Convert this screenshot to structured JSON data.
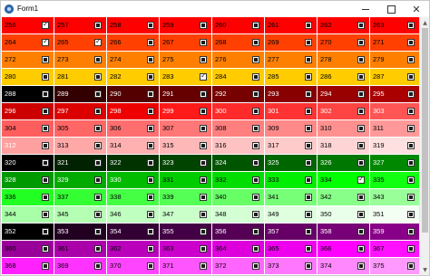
{
  "window": {
    "title": "Form1",
    "controls": {
      "minimize": "—",
      "maximize": "☐",
      "close": "✕"
    }
  },
  "scroll": {
    "up_glyph": "▲",
    "down_glyph": "▼"
  },
  "grid": {
    "rows": [
      {
        "cells": [
          {
            "n": "256",
            "bg": "#ff0000",
            "fg": "#000000",
            "checked": true
          },
          {
            "n": "257",
            "bg": "#ff0000",
            "fg": "#000000",
            "checked": false
          },
          {
            "n": "258",
            "bg": "#ff0000",
            "fg": "#000000",
            "checked": false
          },
          {
            "n": "259",
            "bg": "#ff0000",
            "fg": "#000000",
            "checked": false
          },
          {
            "n": "260",
            "bg": "#ff0000",
            "fg": "#000000",
            "checked": false
          },
          {
            "n": "261",
            "bg": "#ff0000",
            "fg": "#000000",
            "checked": false
          },
          {
            "n": "262",
            "bg": "#ff0000",
            "fg": "#000000",
            "checked": false
          },
          {
            "n": "263",
            "bg": "#ff0000",
            "fg": "#000000",
            "checked": false
          }
        ]
      },
      {
        "cells": [
          {
            "n": "264",
            "bg": "#ff4000",
            "fg": "#000000",
            "checked": true
          },
          {
            "n": "265",
            "bg": "#ff4000",
            "fg": "#000000",
            "checked": true
          },
          {
            "n": "266",
            "bg": "#ff4000",
            "fg": "#000000",
            "checked": false
          },
          {
            "n": "267",
            "bg": "#ff4000",
            "fg": "#000000",
            "checked": false
          },
          {
            "n": "268",
            "bg": "#ff4000",
            "fg": "#000000",
            "checked": false
          },
          {
            "n": "269",
            "bg": "#ff4000",
            "fg": "#000000",
            "checked": false
          },
          {
            "n": "270",
            "bg": "#ff4000",
            "fg": "#000000",
            "checked": false
          },
          {
            "n": "271",
            "bg": "#ff4000",
            "fg": "#000000",
            "checked": false
          }
        ]
      },
      {
        "cells": [
          {
            "n": "272",
            "bg": "#ff8000",
            "fg": "#000000",
            "checked": false
          },
          {
            "n": "273",
            "bg": "#ff8000",
            "fg": "#000000",
            "checked": false
          },
          {
            "n": "274",
            "bg": "#ff8000",
            "fg": "#000000",
            "checked": false
          },
          {
            "n": "275",
            "bg": "#ff8000",
            "fg": "#000000",
            "checked": false
          },
          {
            "n": "276",
            "bg": "#ff8000",
            "fg": "#000000",
            "checked": false
          },
          {
            "n": "277",
            "bg": "#ff8000",
            "fg": "#000000",
            "checked": false
          },
          {
            "n": "278",
            "bg": "#ff8000",
            "fg": "#000000",
            "checked": false
          },
          {
            "n": "279",
            "bg": "#ff8000",
            "fg": "#000000",
            "checked": false
          }
        ]
      },
      {
        "cells": [
          {
            "n": "280",
            "bg": "#ffcc00",
            "fg": "#000000",
            "checked": false
          },
          {
            "n": "281",
            "bg": "#ffcc00",
            "fg": "#000000",
            "checked": false
          },
          {
            "n": "282",
            "bg": "#ffcc00",
            "fg": "#000000",
            "checked": false
          },
          {
            "n": "283",
            "bg": "#ffcc00",
            "fg": "#000000",
            "checked": true
          },
          {
            "n": "284",
            "bg": "#ffcc00",
            "fg": "#000000",
            "checked": false
          },
          {
            "n": "285",
            "bg": "#ffcc00",
            "fg": "#000000",
            "checked": false
          },
          {
            "n": "286",
            "bg": "#ffcc00",
            "fg": "#000000",
            "checked": false
          },
          {
            "n": "287",
            "bg": "#ffcc00",
            "fg": "#000000",
            "checked": false
          }
        ]
      },
      {
        "cells": [
          {
            "n": "288",
            "bg": "#000000",
            "fg": "#ffffff",
            "checked": false
          },
          {
            "n": "289",
            "bg": "#330000",
            "fg": "#ffffff",
            "checked": false
          },
          {
            "n": "290",
            "bg": "#550000",
            "fg": "#ffffff",
            "checked": false
          },
          {
            "n": "291",
            "bg": "#660000",
            "fg": "#ffffff",
            "checked": false
          },
          {
            "n": "292",
            "bg": "#770000",
            "fg": "#ffffff",
            "checked": false
          },
          {
            "n": "293",
            "bg": "#880000",
            "fg": "#ffffff",
            "checked": false
          },
          {
            "n": "294",
            "bg": "#990000",
            "fg": "#ffffff",
            "checked": false
          },
          {
            "n": "295",
            "bg": "#aa0000",
            "fg": "#ffffff",
            "checked": false
          }
        ]
      },
      {
        "cells": [
          {
            "n": "296",
            "bg": "#cc0000",
            "fg": "#ffffff",
            "checked": false
          },
          {
            "n": "297",
            "bg": "#dd0000",
            "fg": "#ffffff",
            "checked": false
          },
          {
            "n": "298",
            "bg": "#ee0000",
            "fg": "#ffffff",
            "checked": false
          },
          {
            "n": "299",
            "bg": "#ff1a1a",
            "fg": "#ffffff",
            "checked": false
          },
          {
            "n": "300",
            "bg": "#ff2a2a",
            "fg": "#ffffff",
            "checked": false
          },
          {
            "n": "301",
            "bg": "#ff3333",
            "fg": "#ffffff",
            "checked": false
          },
          {
            "n": "302",
            "bg": "#ff4444",
            "fg": "#ffffff",
            "checked": false
          },
          {
            "n": "303",
            "bg": "#ff5555",
            "fg": "#ffffff",
            "checked": false
          }
        ]
      },
      {
        "cells": [
          {
            "n": "304",
            "bg": "#ff5e5e",
            "fg": "#000000",
            "checked": false
          },
          {
            "n": "305",
            "bg": "#ff6666",
            "fg": "#000000",
            "checked": false
          },
          {
            "n": "306",
            "bg": "#ff6e6e",
            "fg": "#000000",
            "checked": false
          },
          {
            "n": "307",
            "bg": "#ff7777",
            "fg": "#000000",
            "checked": false
          },
          {
            "n": "308",
            "bg": "#ff7f7f",
            "fg": "#000000",
            "checked": false
          },
          {
            "n": "309",
            "bg": "#ff8888",
            "fg": "#000000",
            "checked": false
          },
          {
            "n": "310",
            "bg": "#ff9090",
            "fg": "#000000",
            "checked": false
          },
          {
            "n": "311",
            "bg": "#ff9999",
            "fg": "#000000",
            "checked": false
          }
        ]
      },
      {
        "cells": [
          {
            "n": "312",
            "bg": "#ffa0a0",
            "fg": "#ffffff",
            "checked": false
          },
          {
            "n": "313",
            "bg": "#ffa8a8",
            "fg": "#000000",
            "checked": false
          },
          {
            "n": "314",
            "bg": "#ffb0b0",
            "fg": "#000000",
            "checked": false
          },
          {
            "n": "315",
            "bg": "#ffb8b8",
            "fg": "#000000",
            "checked": false
          },
          {
            "n": "316",
            "bg": "#ffc2c2",
            "fg": "#000000",
            "checked": false
          },
          {
            "n": "317",
            "bg": "#ffcaca",
            "fg": "#000000",
            "checked": false
          },
          {
            "n": "318",
            "bg": "#ffd4d4",
            "fg": "#000000",
            "checked": false
          },
          {
            "n": "319",
            "bg": "#ffe0e0",
            "fg": "#000000",
            "checked": false
          }
        ]
      },
      {
        "cells": [
          {
            "n": "320",
            "bg": "#000000",
            "fg": "#ffffff",
            "checked": false
          },
          {
            "n": "321",
            "bg": "#002200",
            "fg": "#ffffff",
            "checked": false
          },
          {
            "n": "322",
            "bg": "#003300",
            "fg": "#ffffff",
            "checked": false
          },
          {
            "n": "323",
            "bg": "#004400",
            "fg": "#ffffff",
            "checked": false
          },
          {
            "n": "324",
            "bg": "#005500",
            "fg": "#ffffff",
            "checked": false
          },
          {
            "n": "325",
            "bg": "#006600",
            "fg": "#ffffff",
            "checked": false
          },
          {
            "n": "326",
            "bg": "#007700",
            "fg": "#ffffff",
            "checked": false
          },
          {
            "n": "327",
            "bg": "#008800",
            "fg": "#ffffff",
            "checked": false
          }
        ]
      },
      {
        "cells": [
          {
            "n": "328",
            "bg": "#009900",
            "fg": "#ffffff",
            "checked": false
          },
          {
            "n": "329",
            "bg": "#00aa00",
            "fg": "#ffffff",
            "checked": false
          },
          {
            "n": "330",
            "bg": "#00bb00",
            "fg": "#ffffff",
            "checked": false
          },
          {
            "n": "331",
            "bg": "#00cc00",
            "fg": "#000000",
            "checked": false
          },
          {
            "n": "332",
            "bg": "#00dd00",
            "fg": "#000000",
            "checked": false
          },
          {
            "n": "333",
            "bg": "#00ee00",
            "fg": "#000000",
            "checked": false
          },
          {
            "n": "334",
            "bg": "#00ff00",
            "fg": "#000000",
            "checked": true
          },
          {
            "n": "335",
            "bg": "#11ff11",
            "fg": "#000000",
            "checked": false
          }
        ]
      },
      {
        "cells": [
          {
            "n": "336",
            "bg": "#22ff22",
            "fg": "#000000",
            "checked": false
          },
          {
            "n": "337",
            "bg": "#33ff33",
            "fg": "#000000",
            "checked": false
          },
          {
            "n": "338",
            "bg": "#44ff44",
            "fg": "#000000",
            "checked": false
          },
          {
            "n": "339",
            "bg": "#55ff55",
            "fg": "#000000",
            "checked": false
          },
          {
            "n": "340",
            "bg": "#66ff66",
            "fg": "#000000",
            "checked": false
          },
          {
            "n": "341",
            "bg": "#77ff77",
            "fg": "#000000",
            "checked": false
          },
          {
            "n": "342",
            "bg": "#88ff88",
            "fg": "#000000",
            "checked": false
          },
          {
            "n": "343",
            "bg": "#99ff99",
            "fg": "#000000",
            "checked": false
          }
        ]
      },
      {
        "cells": [
          {
            "n": "344",
            "bg": "#a8ffa8",
            "fg": "#000000",
            "checked": false
          },
          {
            "n": "345",
            "bg": "#b4ffb4",
            "fg": "#000000",
            "checked": false
          },
          {
            "n": "346",
            "bg": "#bfffbf",
            "fg": "#000000",
            "checked": false
          },
          {
            "n": "347",
            "bg": "#caffca",
            "fg": "#000000",
            "checked": false
          },
          {
            "n": "348",
            "bg": "#d4ffd4",
            "fg": "#000000",
            "checked": false
          },
          {
            "n": "349",
            "bg": "#dfffdf",
            "fg": "#000000",
            "checked": false
          },
          {
            "n": "350",
            "bg": "#eaffea",
            "fg": "#000000",
            "checked": false
          },
          {
            "n": "351",
            "bg": "#f4fff4",
            "fg": "#000000",
            "checked": false
          }
        ]
      },
      {
        "cells": [
          {
            "n": "352",
            "bg": "#000000",
            "fg": "#ffffff",
            "checked": false
          },
          {
            "n": "353",
            "bg": "#220022",
            "fg": "#ffffff",
            "checked": false
          },
          {
            "n": "354",
            "bg": "#330033",
            "fg": "#ffffff",
            "checked": false
          },
          {
            "n": "355",
            "bg": "#440044",
            "fg": "#ffffff",
            "checked": false
          },
          {
            "n": "356",
            "bg": "#550055",
            "fg": "#ffffff",
            "checked": false
          },
          {
            "n": "357",
            "bg": "#660066",
            "fg": "#ffffff",
            "checked": false
          },
          {
            "n": "358",
            "bg": "#770077",
            "fg": "#ffffff",
            "checked": false
          },
          {
            "n": "359",
            "bg": "#880088",
            "fg": "#ffffff",
            "checked": false
          }
        ]
      },
      {
        "cells": [
          {
            "n": "360",
            "bg": "#990099",
            "fg": "#000000",
            "checked": false
          },
          {
            "n": "361",
            "bg": "#aa00aa",
            "fg": "#000000",
            "checked": false
          },
          {
            "n": "362",
            "bg": "#bb00bb",
            "fg": "#000000",
            "checked": false
          },
          {
            "n": "363",
            "bg": "#cc00cc",
            "fg": "#000000",
            "checked": false
          },
          {
            "n": "364",
            "bg": "#dd00dd",
            "fg": "#000000",
            "checked": false
          },
          {
            "n": "365",
            "bg": "#ee00ee",
            "fg": "#000000",
            "checked": false
          },
          {
            "n": "366",
            "bg": "#ff00ff",
            "fg": "#000000",
            "checked": false
          },
          {
            "n": "367",
            "bg": "#ff11ff",
            "fg": "#000000",
            "checked": false
          }
        ]
      },
      {
        "cells": [
          {
            "n": "368",
            "bg": "#ff22ff",
            "fg": "#000000",
            "checked": false
          },
          {
            "n": "369",
            "bg": "#ff33ff",
            "fg": "#000000",
            "checked": false
          },
          {
            "n": "370",
            "bg": "#ff44ff",
            "fg": "#000000",
            "checked": false
          },
          {
            "n": "371",
            "bg": "#ff55ff",
            "fg": "#000000",
            "checked": false
          },
          {
            "n": "372",
            "bg": "#ff66ff",
            "fg": "#000000",
            "checked": false
          },
          {
            "n": "373",
            "bg": "#ff77ff",
            "fg": "#000000",
            "checked": false
          },
          {
            "n": "374",
            "bg": "#ff88ff",
            "fg": "#000000",
            "checked": false
          },
          {
            "n": "375",
            "bg": "#ff99ff",
            "fg": "#000000",
            "checked": false
          }
        ]
      }
    ]
  }
}
